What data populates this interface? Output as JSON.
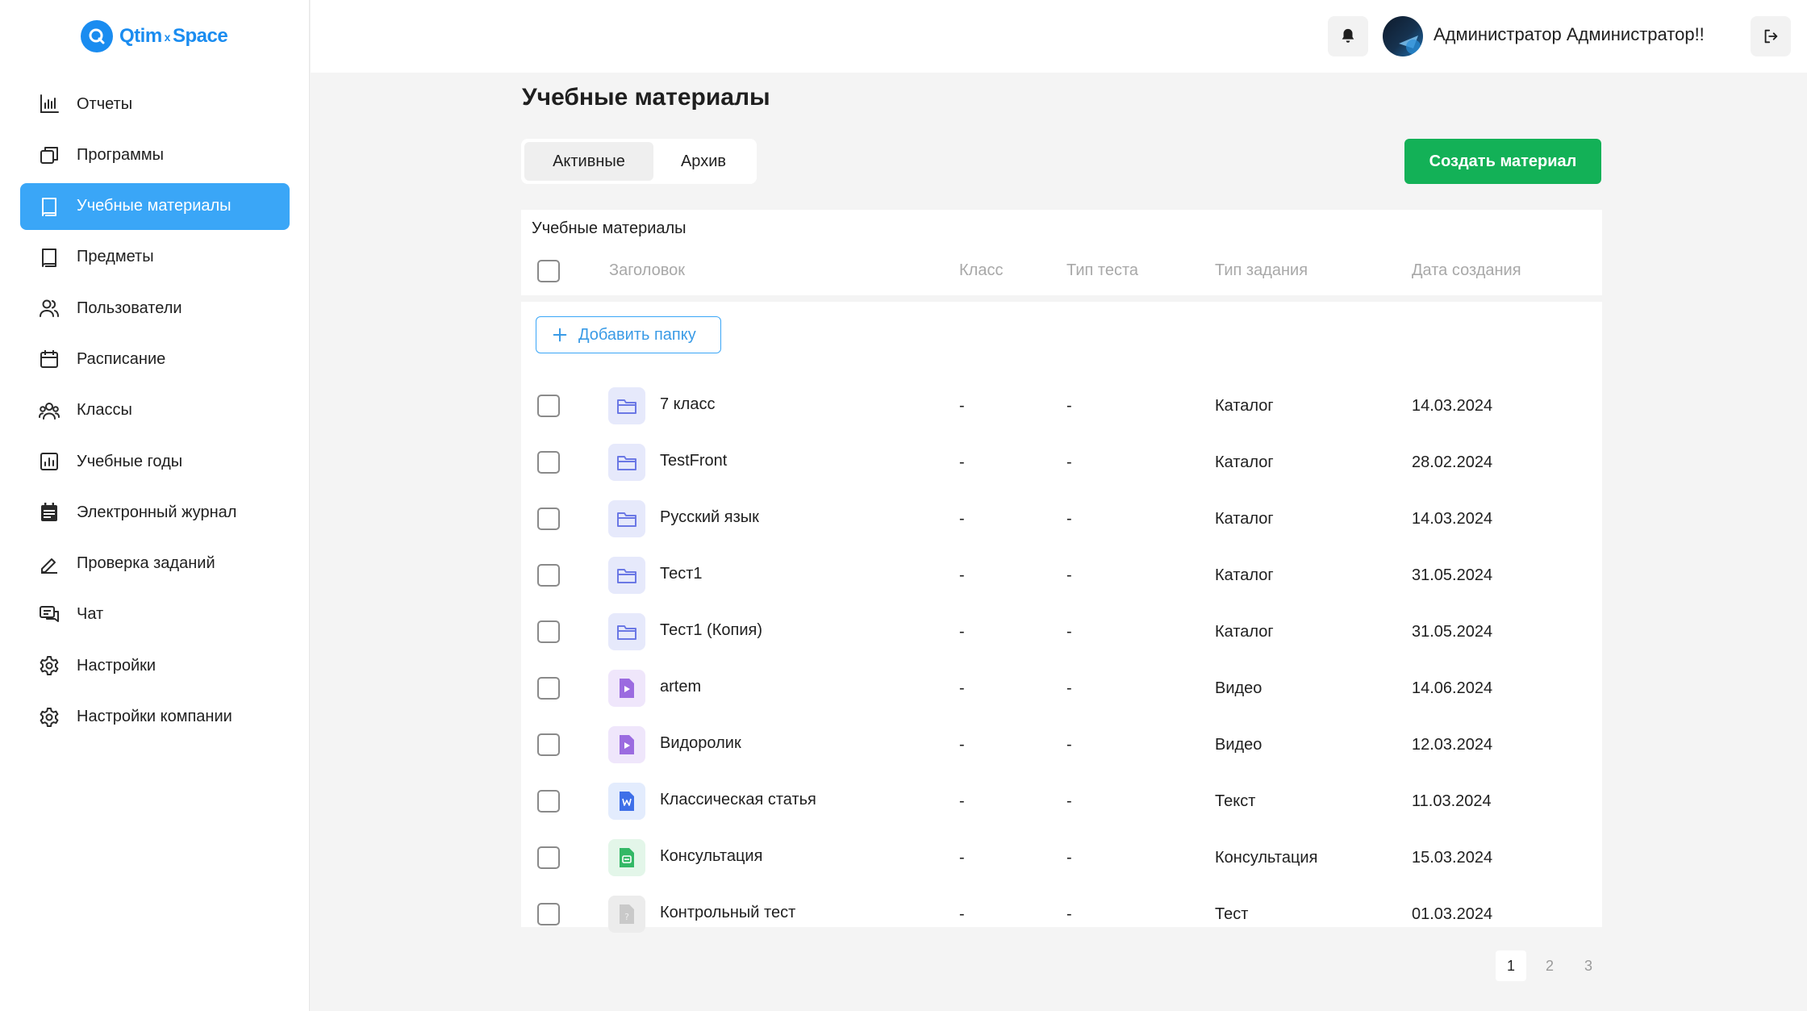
{
  "brand": {
    "name_left": "Qtim",
    "name_sep": "x",
    "name_right": "Space"
  },
  "sidebar": {
    "items": [
      {
        "label": "Отчеты",
        "icon": "bar-chart-icon",
        "active": false
      },
      {
        "label": "Программы",
        "icon": "copy-icon",
        "active": false
      },
      {
        "label": "Учебные материалы",
        "icon": "book-icon",
        "active": true
      },
      {
        "label": "Предметы",
        "icon": "book-icon",
        "active": false
      },
      {
        "label": "Пользователи",
        "icon": "users-icon",
        "active": false
      },
      {
        "label": "Расписание",
        "icon": "calendar-icon",
        "active": false
      },
      {
        "label": "Классы",
        "icon": "group-icon",
        "active": false
      },
      {
        "label": "Учебные годы",
        "icon": "chart-box-icon",
        "active": false
      },
      {
        "label": "Электронный журнал",
        "icon": "journal-icon",
        "active": false
      },
      {
        "label": "Проверка заданий",
        "icon": "pencil-icon",
        "active": false
      },
      {
        "label": "Чат",
        "icon": "chat-icon",
        "active": false
      },
      {
        "label": "Настройки",
        "icon": "gear-icon",
        "active": false
      },
      {
        "label": "Настройки компании",
        "icon": "gear-icon",
        "active": false
      }
    ]
  },
  "header": {
    "username": "Администратор Администратор!!"
  },
  "main": {
    "title": "Учебные материалы",
    "tabs": [
      {
        "label": "Активные",
        "active": true
      },
      {
        "label": "Архив",
        "active": false
      }
    ],
    "create_button": "Создать материал",
    "table": {
      "caption": "Учебные материалы",
      "columns": [
        "Заголовок",
        "Класс",
        "Тип теста",
        "Тип задания",
        "Дата создания"
      ],
      "add_folder": "Добавить папку",
      "rows": [
        {
          "title": "7 класс",
          "class": "-",
          "test_type": "-",
          "task_type": "Каталог",
          "date": "14.03.2024",
          "icon": "folder-icon"
        },
        {
          "title": "TestFront",
          "class": "-",
          "test_type": "-",
          "task_type": "Каталог",
          "date": "28.02.2024",
          "icon": "folder-icon"
        },
        {
          "title": "Русский язык",
          "class": "-",
          "test_type": "-",
          "task_type": "Каталог",
          "date": "14.03.2024",
          "icon": "folder-icon"
        },
        {
          "title": "Тест1",
          "class": "-",
          "test_type": "-",
          "task_type": "Каталог",
          "date": "31.05.2024",
          "icon": "folder-icon"
        },
        {
          "title": "Тест1 (Копия)",
          "class": "-",
          "test_type": "-",
          "task_type": "Каталог",
          "date": "31.05.2024",
          "icon": "folder-icon"
        },
        {
          "title": "artem",
          "class": "-",
          "test_type": "-",
          "task_type": "Видео",
          "date": "14.06.2024",
          "icon": "video-file-icon"
        },
        {
          "title": "Видоролик",
          "class": "-",
          "test_type": "-",
          "task_type": "Видео",
          "date": "12.03.2024",
          "icon": "video-file-icon"
        },
        {
          "title": "Классическая статья",
          "class": "-",
          "test_type": "-",
          "task_type": "Текст",
          "date": "11.03.2024",
          "icon": "word-file-icon"
        },
        {
          "title": "Консультация",
          "class": "-",
          "test_type": "-",
          "task_type": "Консультация",
          "date": "15.03.2024",
          "icon": "consultation-file-icon"
        },
        {
          "title": "Контрольный тест",
          "class": "-",
          "test_type": "-",
          "task_type": "Тест",
          "date": "01.03.2024",
          "icon": "test-file-icon"
        }
      ]
    },
    "pagination": [
      "1",
      "2",
      "3"
    ],
    "current_page": "1"
  },
  "colors": {
    "accent": "#3aa6f7",
    "brand": "#1a8cf0",
    "create_button": "#13b157",
    "folder_bg": "#e6e9fb",
    "folder_stroke": "#6b78e5",
    "video_bg": "#efe6fb",
    "video_fill": "#9b6be0",
    "word_bg": "#e3ecfd",
    "word_fill": "#3e6fe8",
    "consult_bg": "#e3f6e9",
    "consult_fill": "#33b866",
    "test_bg": "#ececec",
    "test_fill": "#c9c9c9"
  }
}
